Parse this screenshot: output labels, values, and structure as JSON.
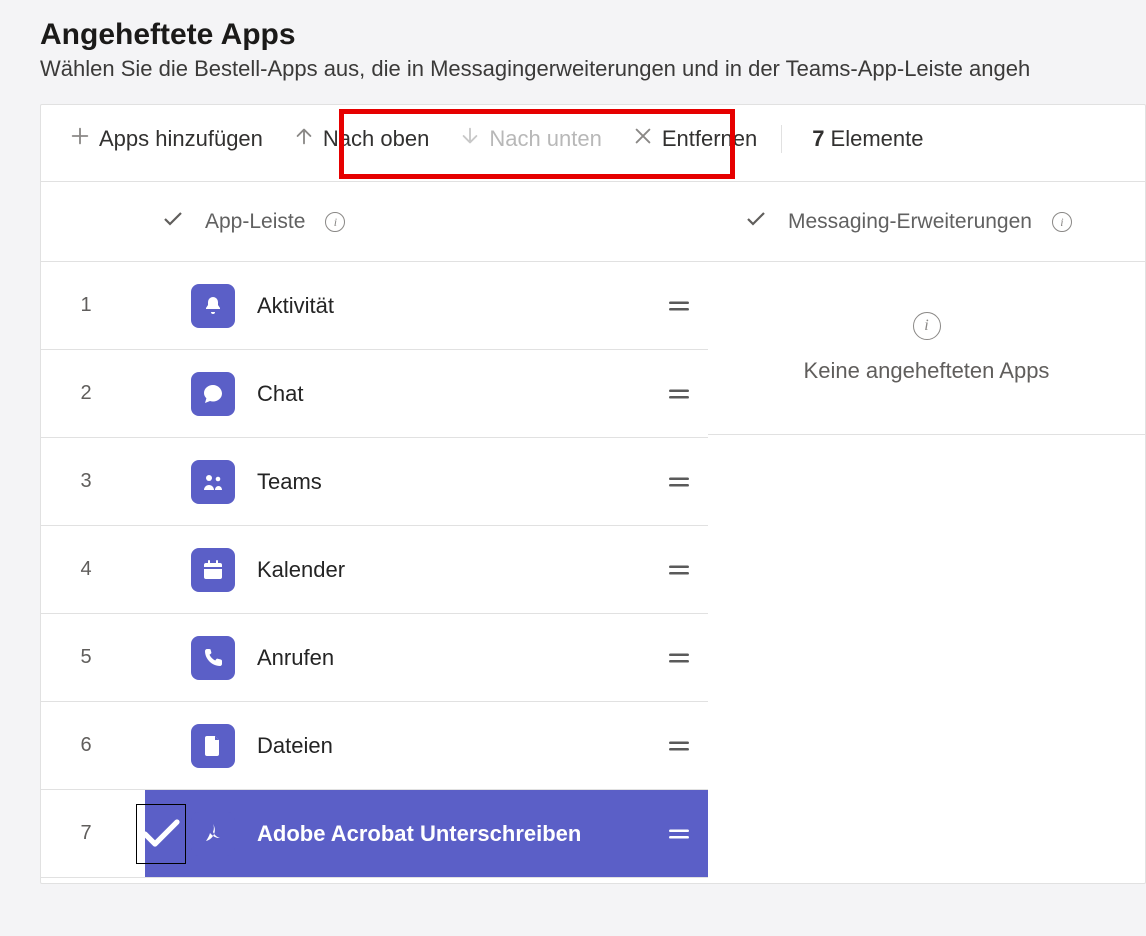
{
  "header": {
    "title": "Angeheftete Apps",
    "subtitle": "Wählen Sie die Bestell-Apps aus, die in Messagingerweiterungen und in der Teams-App-Leiste angeh"
  },
  "toolbar": {
    "add_label": "Apps hinzufügen",
    "move_up_label": "Nach oben",
    "move_down_label": "Nach unten",
    "remove_label": "Entfernen",
    "count_number": "7",
    "count_label": "Elemente"
  },
  "columns": {
    "left_header": "App-Leiste",
    "right_header": "Messaging-Erweiterungen",
    "empty_right": "Keine angehefteten Apps"
  },
  "apps": [
    {
      "idx": "1",
      "name": "Aktivität",
      "icon": "bell",
      "selected": false
    },
    {
      "idx": "2",
      "name": "Chat",
      "icon": "chat",
      "selected": false
    },
    {
      "idx": "3",
      "name": "Teams",
      "icon": "teams",
      "selected": false
    },
    {
      "idx": "4",
      "name": "Kalender",
      "icon": "calendar",
      "selected": false
    },
    {
      "idx": "5",
      "name": "Anrufen",
      "icon": "phone",
      "selected": false
    },
    {
      "idx": "6",
      "name": "Dateien",
      "icon": "file",
      "selected": false
    },
    {
      "idx": "7",
      "name": "Adobe Acrobat Unterschreiben",
      "icon": "acrobat",
      "selected": true
    }
  ]
}
